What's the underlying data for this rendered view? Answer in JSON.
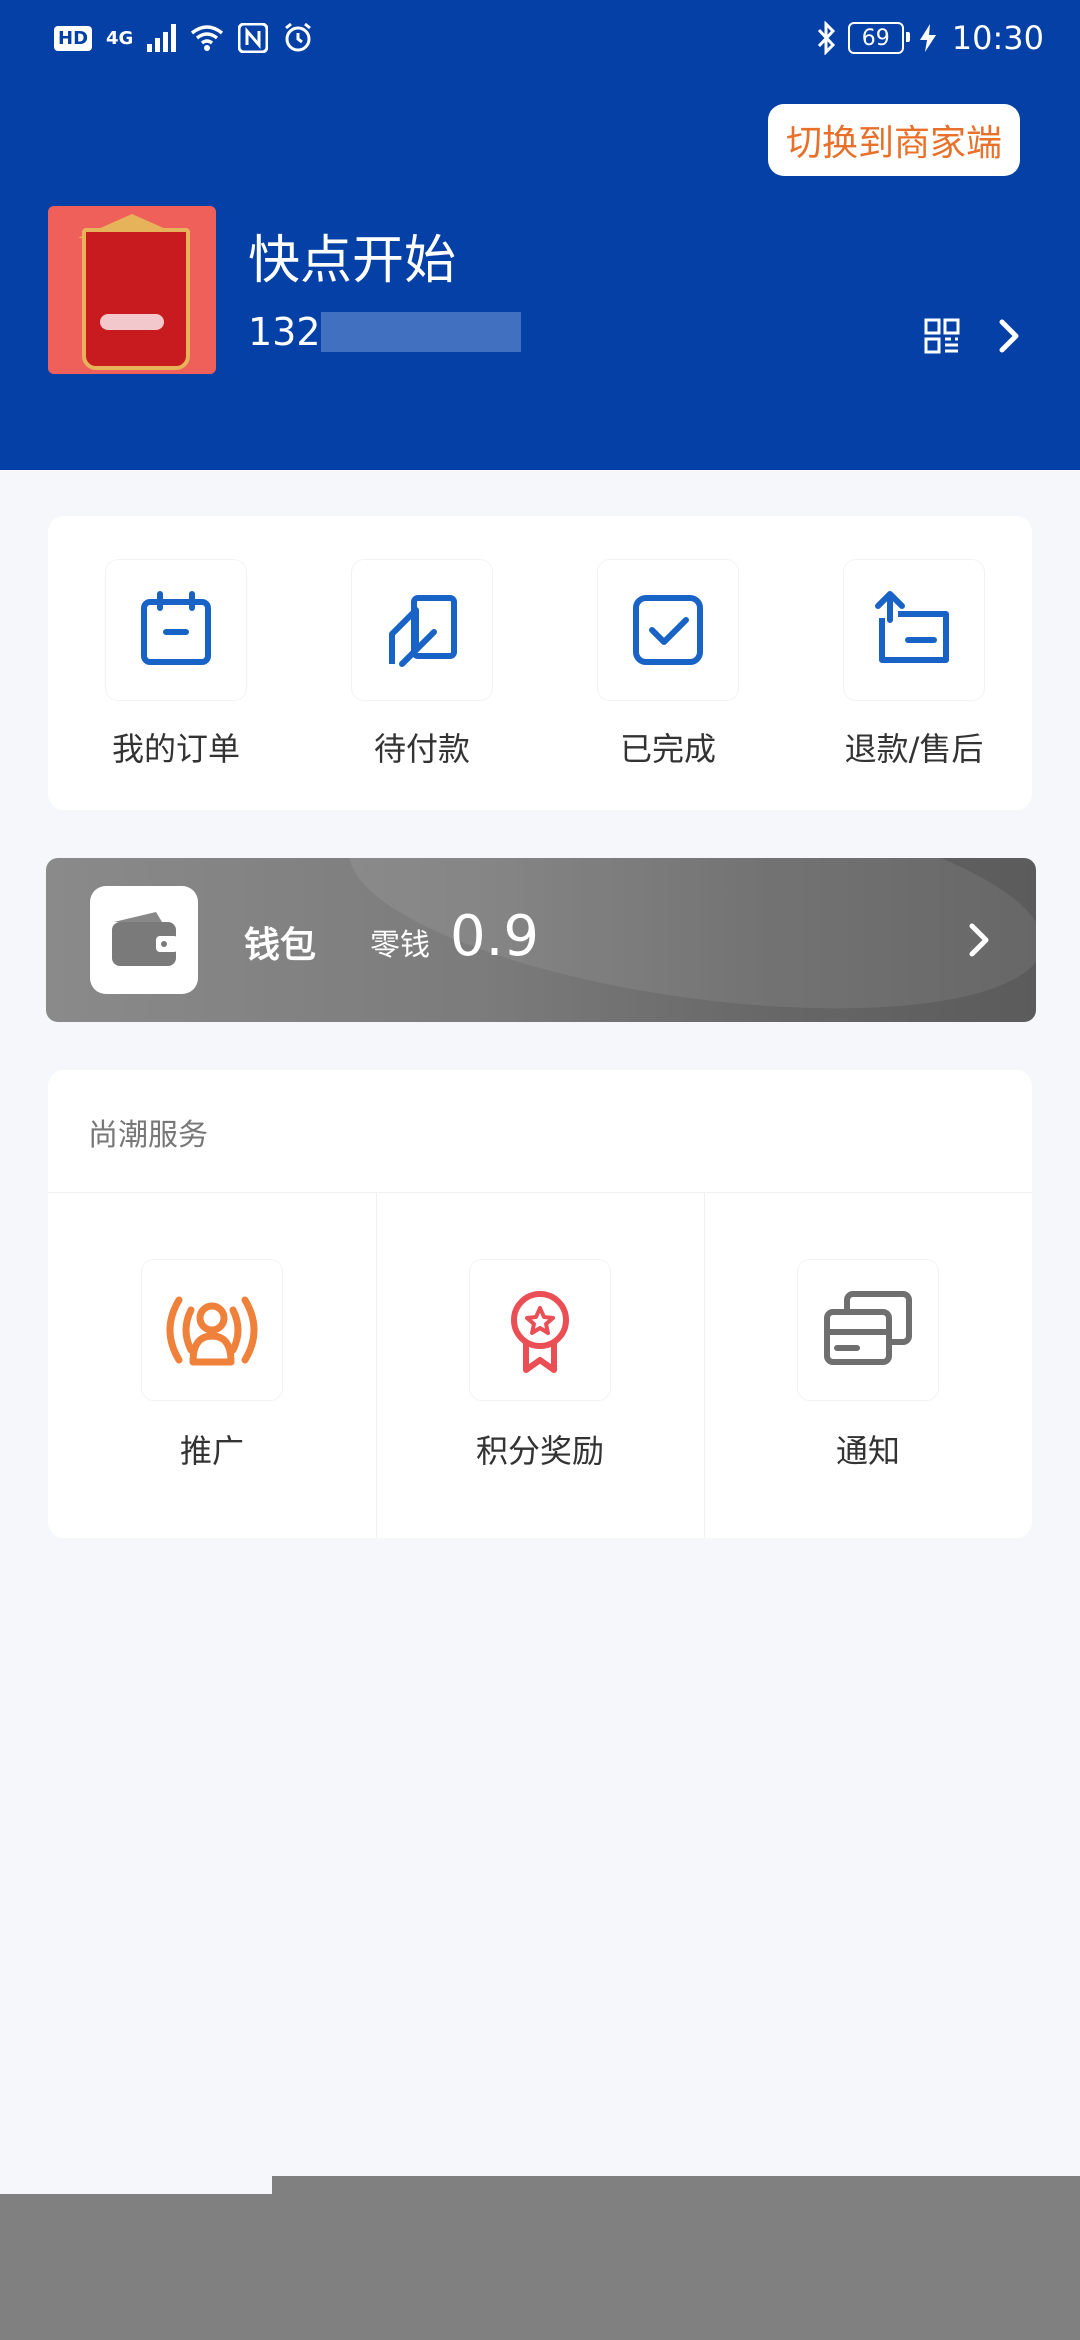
{
  "status_bar": {
    "left_badge": "HD",
    "network": "4G",
    "battery": "69",
    "time": "10:30"
  },
  "header": {
    "switch_button": "切换到商家端",
    "username": "快点开始",
    "phone_prefix": "132"
  },
  "orders": [
    {
      "label": "我的订单",
      "icon": "calendar-icon"
    },
    {
      "label": "待付款",
      "icon": "card-pay-icon"
    },
    {
      "label": "已完成",
      "icon": "checkmark-box-icon"
    },
    {
      "label": "退款/售后",
      "icon": "refund-arrow-icon"
    }
  ],
  "wallet": {
    "title": "钱包",
    "sub_label": "零钱",
    "amount": "0.9",
    "icon": "wallet-icon"
  },
  "services": {
    "title": "尚潮服务",
    "items": [
      {
        "label": "推广",
        "icon": "broadcast-user-icon",
        "color": "#f0813a"
      },
      {
        "label": "积分奖励",
        "icon": "award-medal-icon",
        "color": "#e94f55"
      },
      {
        "label": "通知",
        "icon": "cards-stack-icon",
        "color": "#6f6f6f"
      }
    ]
  },
  "colors": {
    "brand": "#0440a5",
    "accent_orange": "#e9702a",
    "icon_blue": "#1a63c6"
  }
}
